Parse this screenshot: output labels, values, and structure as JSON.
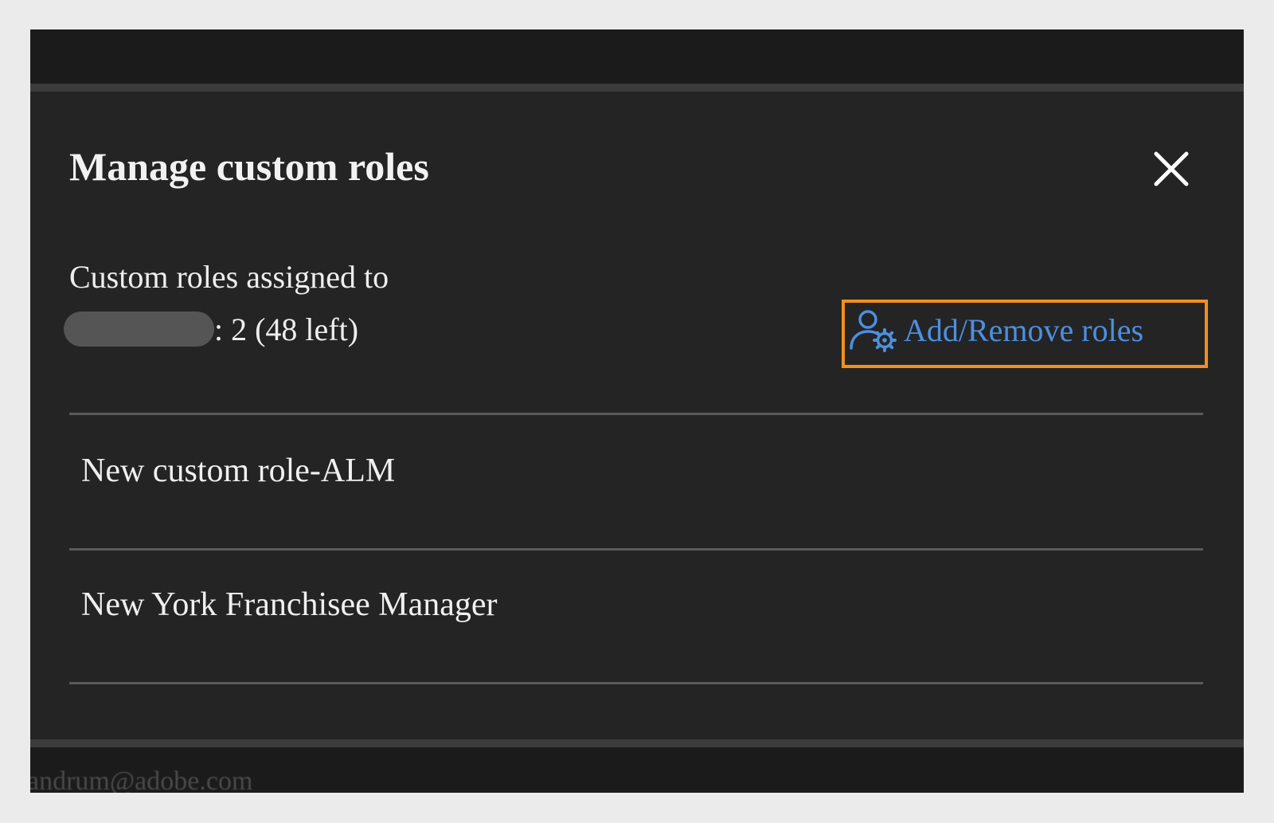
{
  "dialog": {
    "title": "Manage custom roles",
    "summary_line1": "Custom roles assigned to",
    "summary_count": ": 2 (48 left)",
    "add_remove_label": "Add/Remove roles",
    "close_icon": "close-icon",
    "add_remove_icon": "user-gear-icon"
  },
  "roles": [
    {
      "label": "New custom role-ALM"
    },
    {
      "label": "New York Franchisee Manager"
    }
  ],
  "background": {
    "email_text": "andrum@adobe.com"
  },
  "colors": {
    "link": "#4d8fe0",
    "highlight": "#f0901e",
    "panel": "#242424"
  }
}
